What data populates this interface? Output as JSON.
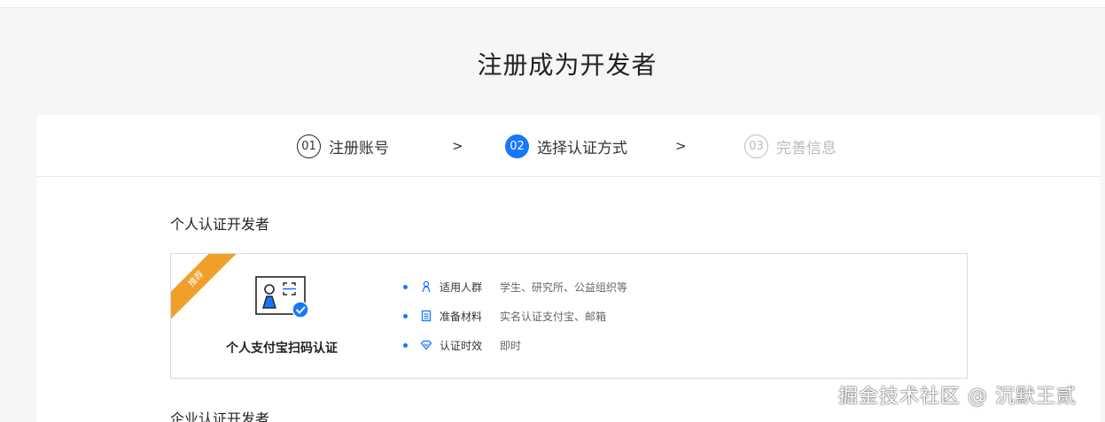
{
  "page": {
    "title": "注册成为开发者"
  },
  "steps": [
    {
      "num": "01",
      "label": "注册账号",
      "state": "done"
    },
    {
      "num": "02",
      "label": "选择认证方式",
      "state": "active"
    },
    {
      "num": "03",
      "label": "完善信息",
      "state": "pending"
    }
  ],
  "step_separator": ">",
  "personal": {
    "section_title": "个人认证开发者",
    "option": {
      "badge": "推荐",
      "title": "个人支付宝扫码认证",
      "attrs": [
        {
          "icon": "person-icon",
          "key": "适用人群",
          "value": "学生、研究所、公益组织等"
        },
        {
          "icon": "document-icon",
          "key": "准备材料",
          "value": "实名认证支付宝、邮箱"
        },
        {
          "icon": "diamond-icon",
          "key": "认证时效",
          "value": "即时"
        }
      ]
    }
  },
  "enterprise": {
    "section_title": "企业认证开发者"
  },
  "watermark": "掘金技术社区 @ 沉默王贰",
  "colors": {
    "accent": "#1677ff",
    "badge": "#f0a02a"
  }
}
